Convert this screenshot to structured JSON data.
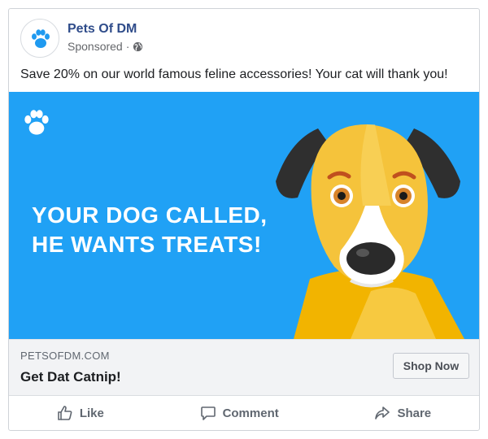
{
  "post": {
    "page_name": "Pets Of DM",
    "sponsored": "Sponsored",
    "separator": "·",
    "privacy_icon": "globe-icon",
    "message": "Save 20% on our world famous feline accessories! Your cat will thank you!"
  },
  "creative": {
    "headline_line1": "YOUR DOG CALLED,",
    "headline_line2": "HE WANTS TREATS!",
    "background_color": "#20a1f5",
    "logo_icon": "paw-icon"
  },
  "link": {
    "domain": "PETSOFDM.COM",
    "title": "Get Dat Catnip!",
    "cta": "Shop Now"
  },
  "actions": {
    "like": "Like",
    "comment": "Comment",
    "share": "Share"
  },
  "colors": {
    "brand": "#2f4c8a",
    "accent": "#20a1f5"
  }
}
